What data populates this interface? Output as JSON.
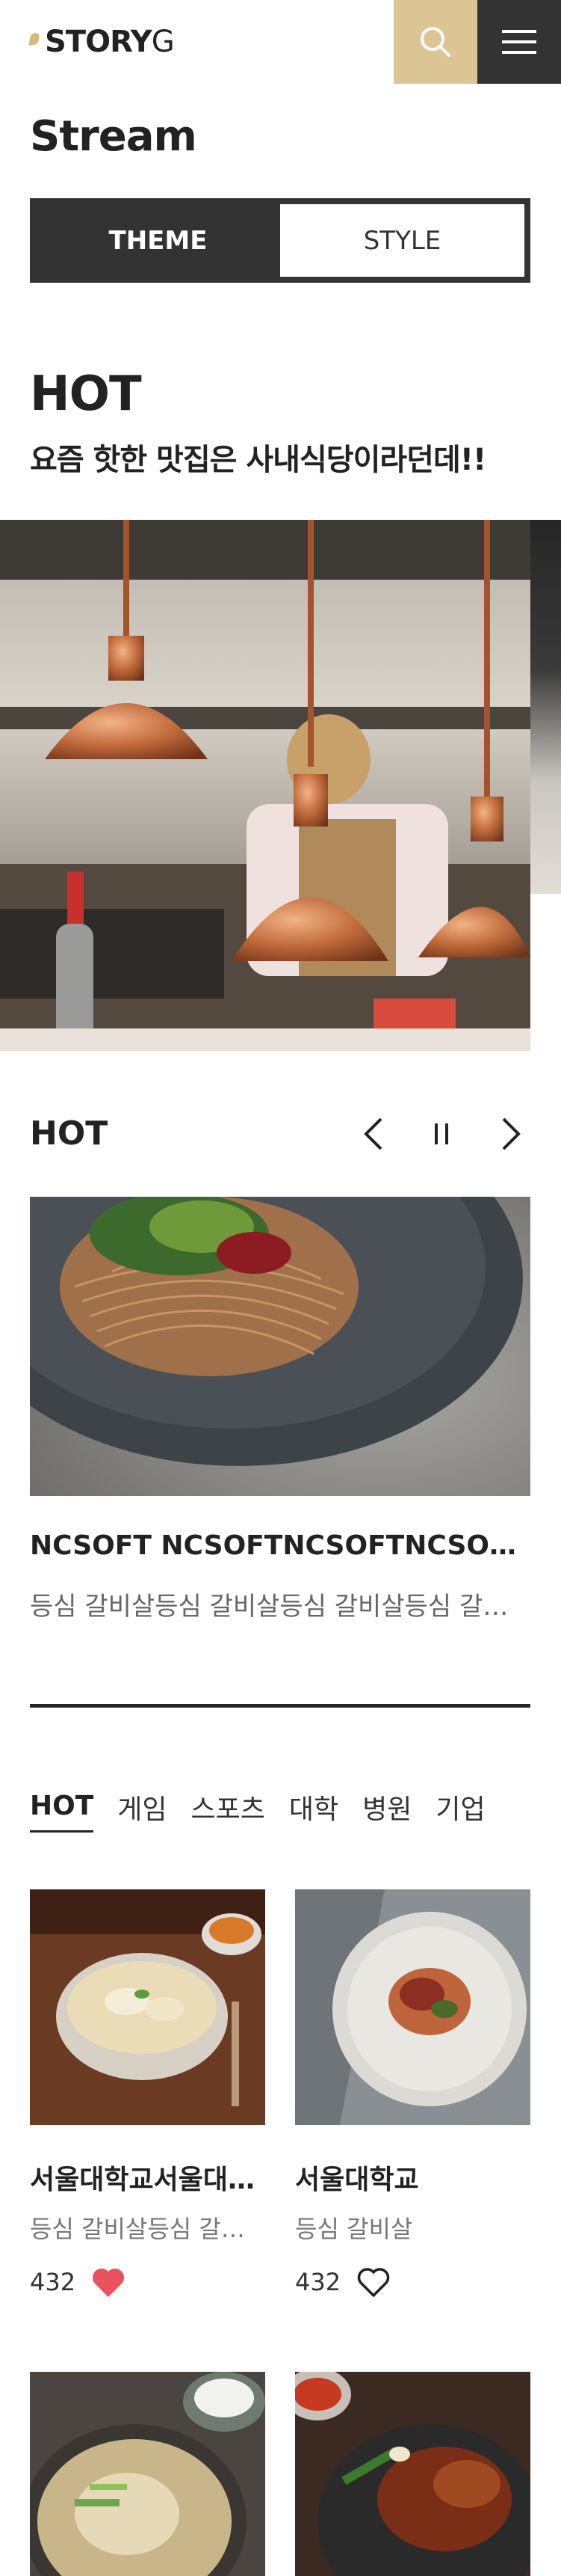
{
  "header": {
    "logo_text_bold": "STORY",
    "logo_text_light": "G",
    "search_icon": "search-icon",
    "menu_icon": "hamburger-menu-icon",
    "accent_color": "#dcc594",
    "dark_color": "#333333"
  },
  "page": {
    "title": "Stream"
  },
  "toggle": {
    "active_label": "THEME",
    "inactive_label": "STYLE"
  },
  "hot_banner": {
    "title": "HOT",
    "subtitle": "요즘 핫한 맛집은 사내식당이라던데!!"
  },
  "slider": {
    "title": "HOT",
    "prev_icon": "chevron-left-icon",
    "pause_icon": "pause-icon",
    "next_icon": "chevron-right-icon",
    "item_title": "NCSOFT NCSOFTNCSOFTNCSOFTNCSOFT",
    "item_desc": "등심 갈비살등심 갈비살등심 갈비살등심 갈비살등심"
  },
  "tabs": [
    {
      "label": "HOT",
      "active": true
    },
    {
      "label": "게임",
      "active": false
    },
    {
      "label": "스포츠",
      "active": false
    },
    {
      "label": "대학",
      "active": false
    },
    {
      "label": "병원",
      "active": false
    },
    {
      "label": "기업",
      "active": false
    }
  ],
  "cards": [
    {
      "title": "서울대학교서울대학교서울대학교",
      "desc": "등심 갈비살등심 갈비살등심",
      "count": "432",
      "liked": true
    },
    {
      "title": "서울대학교",
      "desc": "등심 갈비살",
      "count": "432",
      "liked": false
    }
  ],
  "like_color": "#e8525f"
}
